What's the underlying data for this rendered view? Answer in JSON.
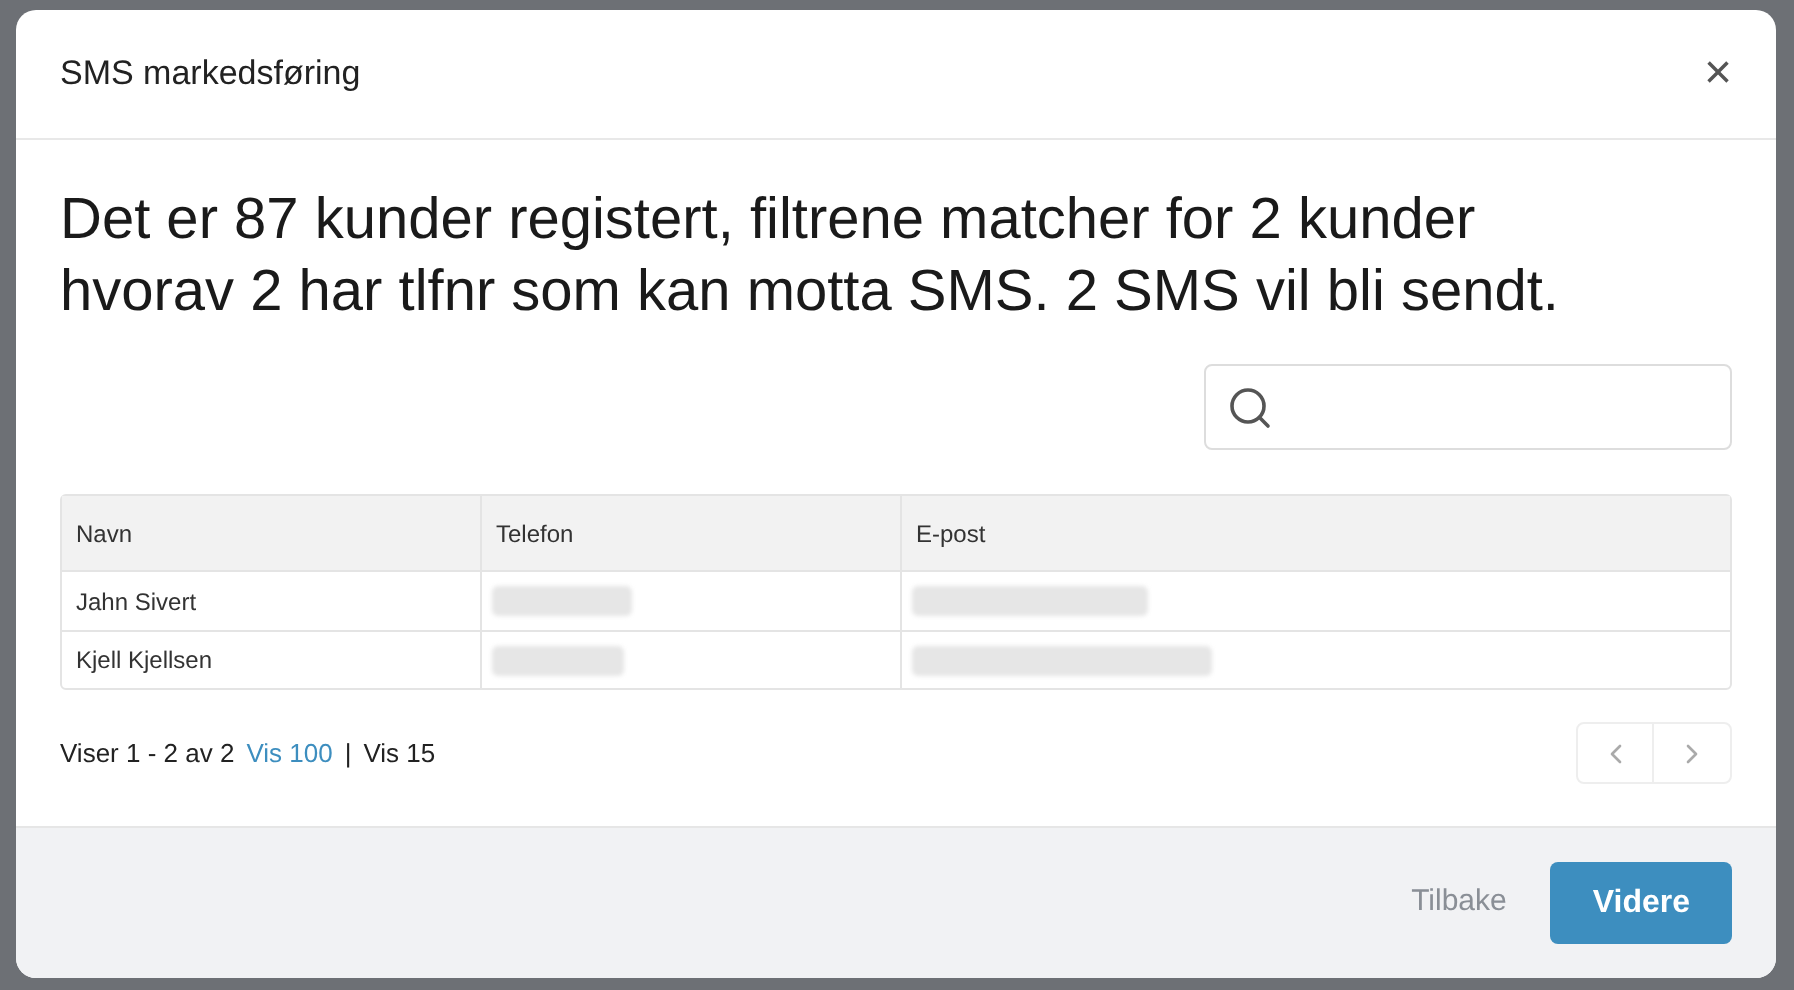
{
  "dialog": {
    "title": "SMS markedsføring",
    "close": "×"
  },
  "summary": "Det er 87 kunder registert, filtrene matcher for 2 kunder hvorav 2 har tlfnr som kan motta SMS. 2 SMS vil bli sendt.",
  "table": {
    "columns": [
      "Navn",
      "Telefon",
      "E-post"
    ],
    "rows": [
      {
        "navn": "Jahn Sivert"
      },
      {
        "navn": "Kjell Kjellsen"
      }
    ]
  },
  "pagination": {
    "info": "Viser 1 - 2 av 2",
    "options": [
      {
        "label": "Vis 100",
        "selected": false
      },
      {
        "label": "Vis 15",
        "selected": true
      }
    ],
    "separator": "|"
  },
  "buttons": [
    {
      "label": "Tilbake",
      "kind": "secondary"
    },
    {
      "label": "Videre",
      "kind": "primary"
    }
  ]
}
